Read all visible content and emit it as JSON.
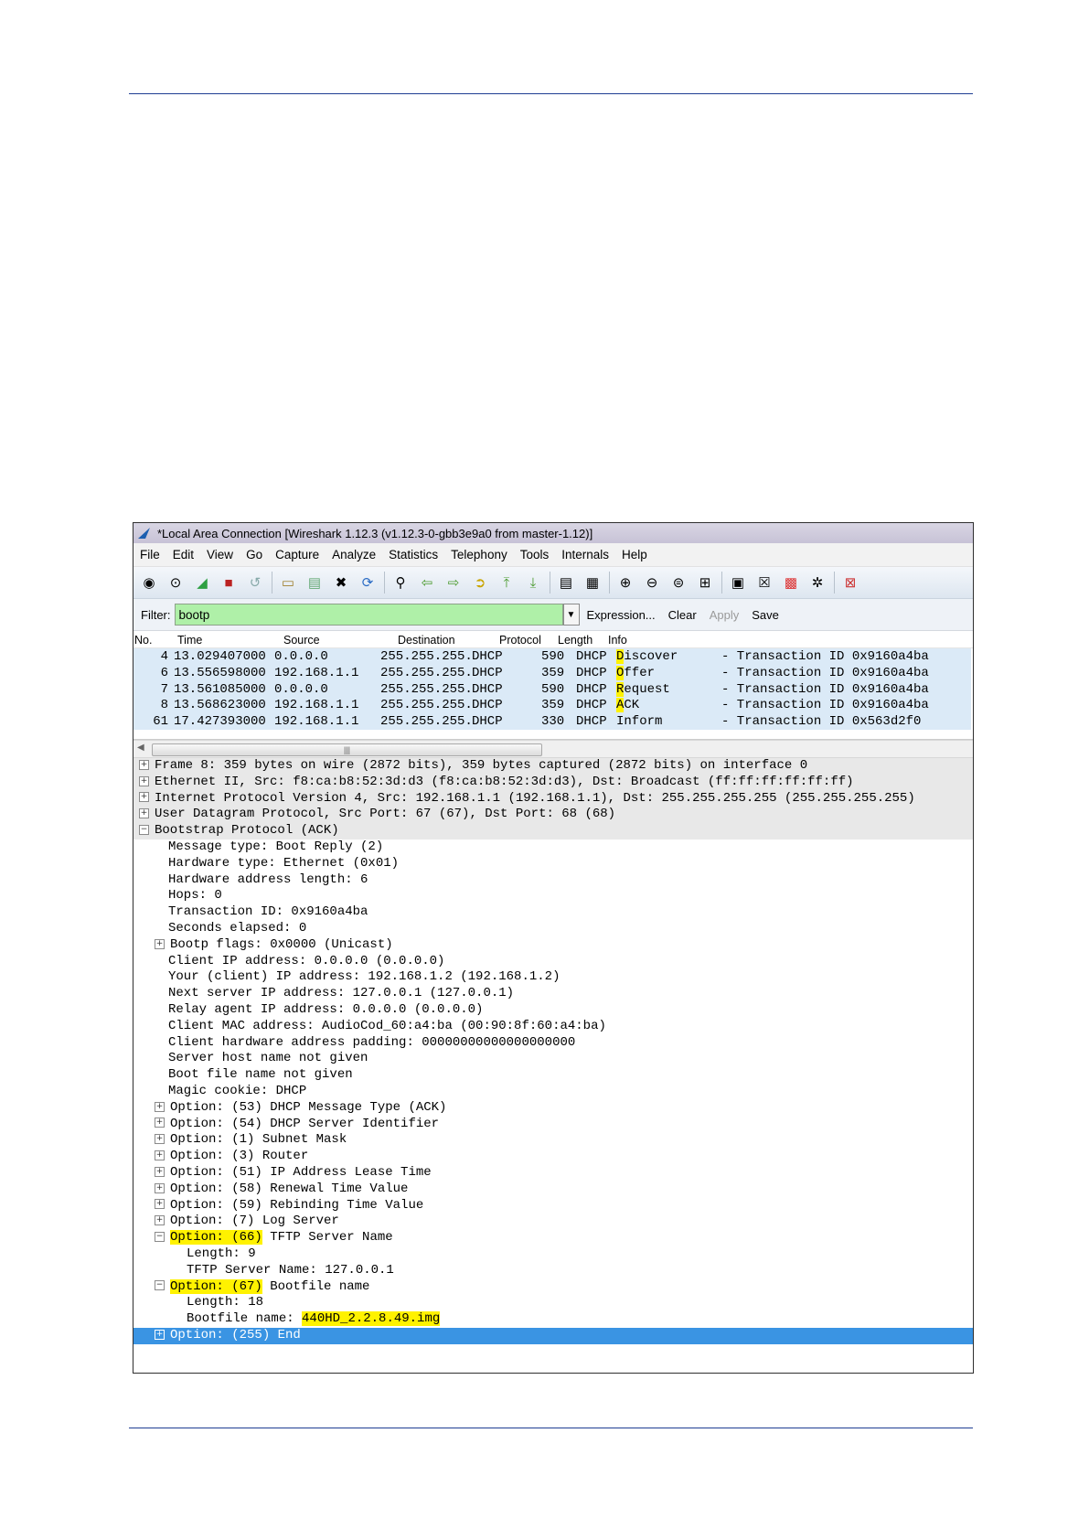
{
  "window": {
    "title": "*Local Area Connection   [Wireshark 1.12.3  (v1.12.3-0-gbb3e9a0 from master-1.12)]"
  },
  "menu": [
    "File",
    "Edit",
    "View",
    "Go",
    "Capture",
    "Analyze",
    "Statistics",
    "Telephony",
    "Tools",
    "Internals",
    "Help"
  ],
  "toolbar_icons": [
    "interfaces-icon",
    "options-icon",
    "start-capture-icon",
    "stop-capture-icon",
    "restart-capture-icon",
    "open-file-icon",
    "save-file-icon",
    "close-file-icon",
    "reload-icon",
    "find-packet-icon",
    "go-back-icon",
    "go-forward-icon",
    "go-to-packet-icon",
    "go-first-icon",
    "go-last-icon",
    "colorize-icon",
    "auto-scroll-icon",
    "zoom-in-icon",
    "zoom-out-icon",
    "normal-size-icon",
    "resize-columns-icon",
    "capture-filters-icon",
    "display-filters-icon",
    "coloring-rules-icon",
    "preferences-icon",
    "help-icon"
  ],
  "filter": {
    "label": "Filter:",
    "value": "bootp",
    "buttons": [
      "Expression...",
      "Clear",
      "Apply",
      "Save"
    ]
  },
  "packet_list": {
    "columns": [
      "No.",
      "Time",
      "Source",
      "Destination",
      "Protocol",
      "Length",
      "Info"
    ],
    "rows": [
      {
        "no": "4",
        "time": "13.029407000",
        "source": "0.0.0.0",
        "destination": "255.255.255.",
        "protocol": "DHCP",
        "length": "590",
        "info_proto": "DHCP",
        "info_first": "D",
        "info_rest": "iscover",
        "info_tail": "- Transaction ID 0x9160a4ba"
      },
      {
        "no": "6",
        "time": "13.556598000",
        "source": "192.168.1.1",
        "destination": "255.255.255.",
        "protocol": "DHCP",
        "length": "359",
        "info_proto": "DHCP",
        "info_first": "O",
        "info_rest": "ffer",
        "info_tail": "- Transaction ID 0x9160a4ba"
      },
      {
        "no": "7",
        "time": "13.561085000",
        "source": "0.0.0.0",
        "destination": "255.255.255.",
        "protocol": "DHCP",
        "length": "590",
        "info_proto": "DHCP",
        "info_first": "R",
        "info_rest": "equest",
        "info_tail": "- Transaction ID 0x9160a4ba"
      },
      {
        "no": "8",
        "time": "13.568623000",
        "source": "192.168.1.1",
        "destination": "255.255.255.",
        "protocol": "DHCP",
        "length": "359",
        "info_proto": "DHCP",
        "info_first": "A",
        "info_rest": "CK",
        "info_tail": "- Transaction ID 0x9160a4ba"
      },
      {
        "no": "61",
        "time": "17.427393000",
        "source": "192.168.1.1",
        "destination": "255.255.255.",
        "protocol": "DHCP",
        "length": "330",
        "info_proto": "DHCP",
        "info_first": "",
        "info_rest": "Inform",
        "info_tail": "- Transaction ID 0x563d2f0"
      }
    ]
  },
  "details": {
    "top": [
      "Frame 8: 359 bytes on wire (2872 bits), 359 bytes captured (2872 bits) on interface 0",
      "Ethernet II, Src: f8:ca:b8:52:3d:d3 (f8:ca:b8:52:3d:d3), Dst: Broadcast (ff:ff:ff:ff:ff:ff)",
      "Internet Protocol Version 4, Src: 192.168.1.1 (192.168.1.1), Dst: 255.255.255.255 (255.255.255.255)",
      "User Datagram Protocol, Src Port: 67 (67), Dst Port: 68 (68)"
    ],
    "bootstrap": "Bootstrap Protocol (ACK)",
    "fields1": [
      "Message type: Boot Reply (2)",
      "Hardware type: Ethernet (0x01)",
      "Hardware address length: 6",
      "Hops: 0",
      "Transaction ID: 0x9160a4ba",
      "Seconds elapsed: 0"
    ],
    "bootp_flags": "Bootp flags: 0x0000 (Unicast)",
    "fields2": [
      "Client IP address: 0.0.0.0 (0.0.0.0)",
      "Your (client) IP address: 192.168.1.2 (192.168.1.2)",
      "Next server IP address: 127.0.0.1 (127.0.0.1)",
      "Relay agent IP address: 0.0.0.0 (0.0.0.0)",
      "Client MAC address: AudioCod_60:a4:ba (00:90:8f:60:a4:ba)",
      "Client hardware address padding: 00000000000000000000",
      "Server host name not given",
      "Boot file name not given",
      "Magic cookie: DHCP"
    ],
    "options": [
      "Option: (53) DHCP Message Type (ACK)",
      "Option: (54) DHCP Server Identifier",
      "Option: (1) Subnet Mask",
      "Option: (3) Router",
      "Option: (51) IP Address Lease Time",
      "Option: (58) Renewal Time Value",
      "Option: (59) Rebinding Time Value",
      "Option: (7) Log Server"
    ],
    "opt66_hl": "Option: (66)",
    "opt66_rest": " TFTP Server Name",
    "opt66_length": "Length: 9",
    "opt66_value": "TFTP Server Name: 127.0.0.1",
    "opt67_hl": "Option: (67)",
    "opt67_rest": " Bootfile name",
    "opt67_length": "Length: 18",
    "opt67_value_label": "Bootfile name: ",
    "opt67_value": "440HD_2.2.8.49.img",
    "opt255": "Option: (255) End"
  },
  "colors": {
    "highlight": "#fff200",
    "filter_bg": "#aff0a8",
    "row_bg": "#dbeaf7",
    "selected_row": "#3a94e3",
    "rule": "#1f3f93"
  }
}
